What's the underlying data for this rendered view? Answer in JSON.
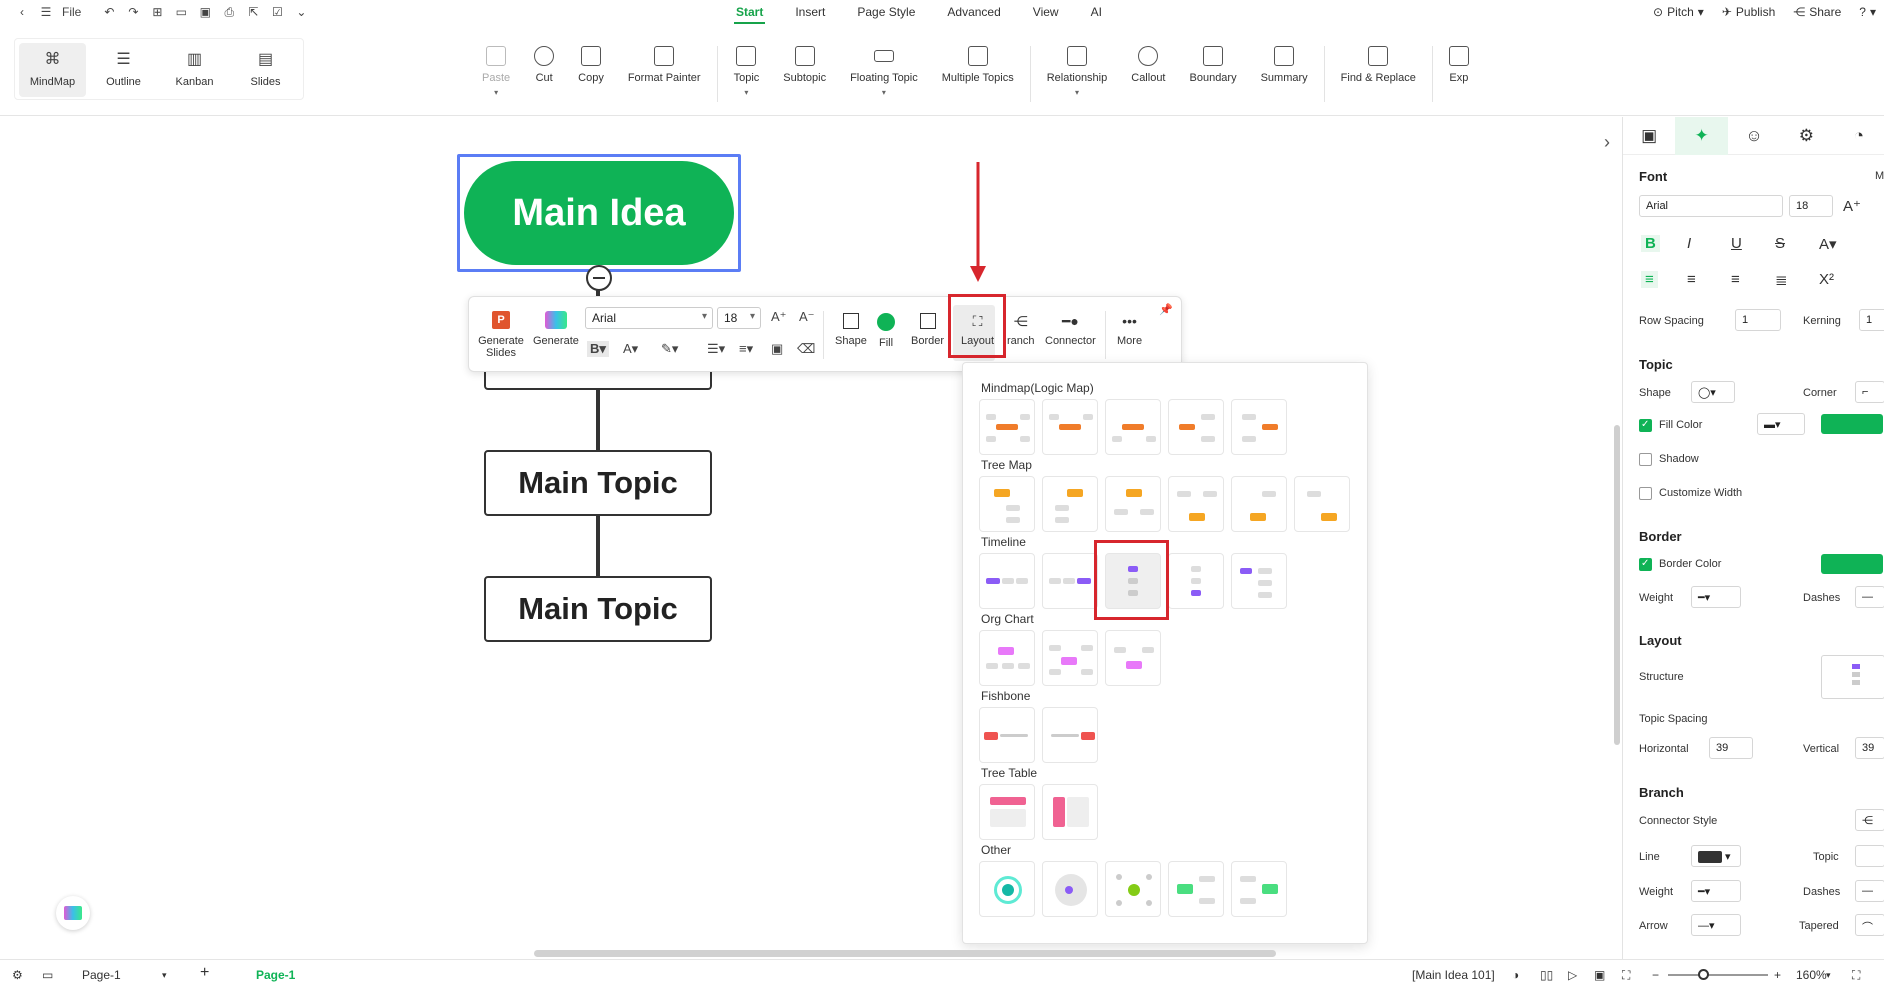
{
  "menubar": {
    "file": "File",
    "tabs": [
      "Start",
      "Insert",
      "Page Style",
      "Advanced",
      "View",
      "AI"
    ],
    "active_tab": "Start",
    "right": {
      "pitch": "Pitch",
      "publish": "Publish",
      "share": "Share"
    }
  },
  "views": [
    "MindMap",
    "Outline",
    "Kanban",
    "Slides"
  ],
  "ribbon": {
    "paste": "Paste",
    "cut": "Cut",
    "copy": "Copy",
    "format_painter": "Format Painter",
    "topic": "Topic",
    "subtopic": "Subtopic",
    "floating_topic": "Floating Topic",
    "multiple_topics": "Multiple Topics",
    "relationship": "Relationship",
    "callout": "Callout",
    "boundary": "Boundary",
    "summary": "Summary",
    "find_replace": "Find & Replace",
    "export": "Exp"
  },
  "canvas": {
    "main_idea": "Main Idea",
    "topics": [
      "Main Topic",
      "Main Topic"
    ]
  },
  "floatbar": {
    "generate_slides": "Generate Slides",
    "generate": "Generate",
    "font": "Arial",
    "size": "18",
    "shape": "Shape",
    "fill": "Fill",
    "border": "Border",
    "layout": "Layout",
    "branch": "ranch",
    "connector": "Connector",
    "more": "More"
  },
  "layout_panel": {
    "sections": [
      "Mindmap(Logic Map)",
      "Tree Map",
      "Timeline",
      "Org Chart",
      "Fishbone",
      "Tree Table",
      "Other"
    ]
  },
  "rpanel": {
    "font_h": "Font",
    "font_name": "Arial",
    "font_size": "18",
    "m_label": "M",
    "row_spacing": "Row Spacing",
    "row_spacing_val": "1",
    "kerning": "Kerning",
    "kerning_val": "1",
    "topic_h": "Topic",
    "shape": "Shape",
    "corner": "Corner",
    "fill_color": "Fill Color",
    "shadow": "Shadow",
    "customize_width": "Customize Width",
    "border_h": "Border",
    "border_color": "Border Color",
    "weight": "Weight",
    "dashes": "Dashes",
    "layout_h": "Layout",
    "structure": "Structure",
    "topic_spacing": "Topic Spacing",
    "horizontal": "Horizontal",
    "horizontal_val": "39",
    "vertical": "Vertical",
    "vertical_val": "39",
    "branch_h": "Branch",
    "connector_style": "Connector Style",
    "line": "Line",
    "topic": "Topic",
    "weight2": "Weight",
    "dashes2": "Dashes",
    "arrow": "Arrow",
    "tapered": "Tapered"
  },
  "status": {
    "page_select": "Page-1",
    "page_tab": "Page-1",
    "selection": "[Main Idea 101]",
    "zoom": "160%"
  },
  "colors": {
    "accent": "#0fb356",
    "highlight": "#d7262d",
    "selection": "#5b7df5"
  }
}
